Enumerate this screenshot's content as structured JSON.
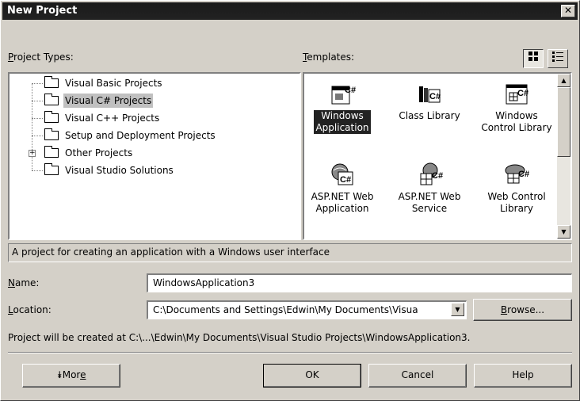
{
  "title": "New Project",
  "close_glyph": "✕",
  "project_types": {
    "label_prefix": "",
    "label_hotkey": "P",
    "label_rest": "roject Types:",
    "items": [
      {
        "label": "Visual Basic Projects",
        "icon": "folder-icon"
      },
      {
        "label": "Visual C# Projects",
        "icon": "open-folder-icon",
        "selected": true
      },
      {
        "label": "Visual C++ Projects",
        "icon": "folder-icon"
      },
      {
        "label": "Setup and Deployment Projects",
        "icon": "folder-icon"
      },
      {
        "label": "Other Projects",
        "icon": "folder-icon",
        "expandable": true
      },
      {
        "label": "Visual Studio Solutions",
        "icon": "folder-icon"
      }
    ]
  },
  "templates": {
    "label_hotkey": "T",
    "label_rest": "emplates:",
    "items": [
      {
        "label": "Windows Application",
        "line1": "Windows",
        "line2": "Application",
        "icon": "windows-app-icon",
        "selected": true
      },
      {
        "label": "Class Library",
        "line1": "Class Library",
        "line2": "",
        "icon": "class-library-icon"
      },
      {
        "label": "Windows Control Library",
        "line1": "Windows",
        "line2": "Control Library",
        "icon": "windows-control-library-icon"
      },
      {
        "label": "ASP.NET Web Application",
        "line1": "ASP.NET Web",
        "line2": "Application",
        "icon": "web-app-icon"
      },
      {
        "label": "ASP.NET Web Service",
        "line1": "ASP.NET Web",
        "line2": "Service",
        "icon": "web-service-icon"
      },
      {
        "label": "Web Control Library",
        "line1": "Web Control",
        "line2": "Library",
        "icon": "web-control-library-icon"
      }
    ],
    "csharp_badge": "C#"
  },
  "view_buttons": {
    "large_icons": "large-icons-view",
    "small_icons": "list-view"
  },
  "description": "A project for creating an application with a Windows user interface",
  "name": {
    "hotkey": "N",
    "label_rest": "ame:",
    "value": "WindowsApplication3"
  },
  "location": {
    "hotkey": "L",
    "label_rest": "ocation:",
    "value": "C:\\Documents and Settings\\Edwin\\My Documents\\Visua",
    "dropdown_glyph": "▼"
  },
  "browse_button": {
    "hotkey": "B",
    "rest": "rowse..."
  },
  "created_at": "Project will be created at C:\\...\\Edwin\\My Documents\\Visual Studio Projects\\WindowsApplication3.",
  "buttons": {
    "more_glyph": "⯯",
    "more_prefix": "Mor",
    "more_hotkey": "e",
    "ok": "OK",
    "cancel": "Cancel",
    "help": "Help"
  }
}
